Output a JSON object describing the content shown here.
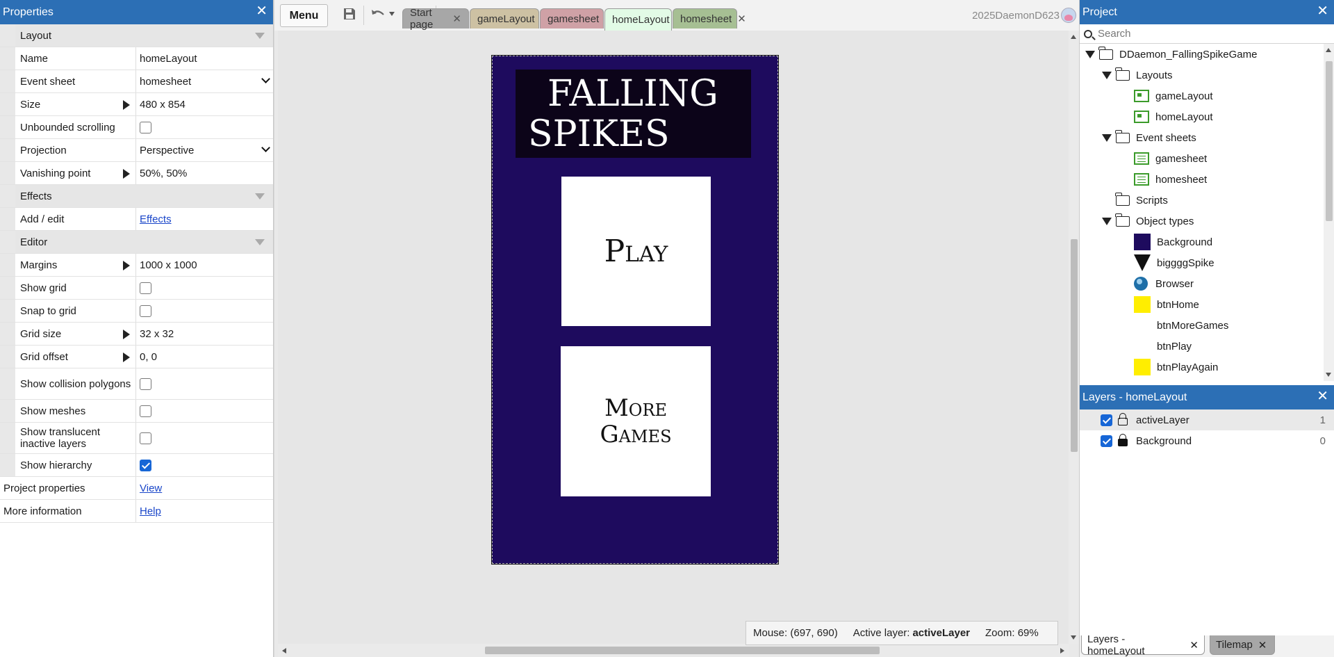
{
  "properties": {
    "title": "Properties",
    "rows": [
      {
        "type": "section",
        "label": "Layout"
      },
      {
        "type": "text",
        "label": "Name",
        "value": "homeLayout"
      },
      {
        "type": "select",
        "label": "Event sheet",
        "value": "homesheet"
      },
      {
        "type": "expand",
        "label": "Size",
        "value": "480 x 854"
      },
      {
        "type": "check",
        "label": "Unbounded scrolling",
        "checked": false
      },
      {
        "type": "select",
        "label": "Projection",
        "value": "Perspective"
      },
      {
        "type": "expand",
        "label": "Vanishing point",
        "value": "50%, 50%"
      },
      {
        "type": "section",
        "label": "Effects"
      },
      {
        "type": "link",
        "label": "Add / edit",
        "value": "Effects"
      },
      {
        "type": "section",
        "label": "Editor"
      },
      {
        "type": "expand",
        "label": "Margins",
        "value": "1000 x 1000"
      },
      {
        "type": "check",
        "label": "Show grid",
        "checked": false
      },
      {
        "type": "check",
        "label": "Snap to grid",
        "checked": false
      },
      {
        "type": "expand",
        "label": "Grid size",
        "value": "32 x 32"
      },
      {
        "type": "expand",
        "label": "Grid offset",
        "value": "0, 0"
      },
      {
        "type": "check",
        "label": "Show collision polygons",
        "checked": false,
        "tall": true
      },
      {
        "type": "check",
        "label": "Show meshes",
        "checked": false
      },
      {
        "type": "check",
        "label": "Show translucent inactive layers",
        "checked": false,
        "tall": true
      },
      {
        "type": "check",
        "label": "Show hierarchy",
        "checked": true
      },
      {
        "type": "link",
        "label": "Project properties",
        "value": "View",
        "nogutter": true
      },
      {
        "type": "link",
        "label": "More information",
        "value": "Help",
        "nogutter": true
      }
    ]
  },
  "toolbar": {
    "menu_label": "Menu",
    "user": "2025DaemonD623",
    "tabs": [
      {
        "label": "Start page",
        "color": "#a7a7a7"
      },
      {
        "label": "gameLayout",
        "color": "#cdc1a3"
      },
      {
        "label": "gamesheet",
        "color": "#cfa1a6"
      },
      {
        "label": "homeLayout",
        "color": "#e2fbe6",
        "active": true
      },
      {
        "label": "homesheet",
        "color": "#a6bf93"
      }
    ]
  },
  "layout_view": {
    "background_color": "#1e0b5e",
    "title_line1": "FALLING",
    "title_line2": "SPIKES",
    "play_label": "Play",
    "more_label_line1": "More",
    "more_label_line2": "Games"
  },
  "statusbar": {
    "mouse": "Mouse: (697, 690)",
    "active_layer_label": "Active layer:",
    "active_layer_value": "activeLayer",
    "zoom": "Zoom: 69%"
  },
  "project": {
    "title": "Project",
    "search_placeholder": "Search",
    "tree": [
      {
        "depth": 0,
        "kind": "folder",
        "twist": true,
        "label": "DDaemon_FallingSpikeGame"
      },
      {
        "depth": 1,
        "kind": "folder",
        "twist": true,
        "label": "Layouts"
      },
      {
        "depth": 2,
        "kind": "layout",
        "label": "gameLayout"
      },
      {
        "depth": 2,
        "kind": "layout",
        "label": "homeLayout"
      },
      {
        "depth": 1,
        "kind": "folder",
        "twist": true,
        "label": "Event sheets"
      },
      {
        "depth": 2,
        "kind": "sheet",
        "label": "gamesheet"
      },
      {
        "depth": 2,
        "kind": "sheet",
        "label": "homesheet"
      },
      {
        "depth": 1,
        "kind": "folder",
        "twist": false,
        "label": "Scripts"
      },
      {
        "depth": 1,
        "kind": "folder",
        "twist": true,
        "label": "Object types"
      },
      {
        "depth": 2,
        "kind": "swatch",
        "color": "#1e0b5e",
        "label": "Background"
      },
      {
        "depth": 2,
        "kind": "triangle",
        "label": "biggggSpike"
      },
      {
        "depth": 2,
        "kind": "globe",
        "label": "Browser"
      },
      {
        "depth": 2,
        "kind": "swatch",
        "color": "#ffee00",
        "label": "btnHome"
      },
      {
        "depth": 2,
        "kind": "none",
        "label": "btnMoreGames"
      },
      {
        "depth": 2,
        "kind": "none",
        "label": "btnPlay"
      },
      {
        "depth": 2,
        "kind": "swatch",
        "color": "#ffee00",
        "label": "btnPlayAgain"
      }
    ]
  },
  "layers": {
    "title": "Layers - homeLayout",
    "items": [
      {
        "label": "activeLayer",
        "count": "1",
        "visible": true,
        "locked": false,
        "active": true
      },
      {
        "label": "Background",
        "count": "0",
        "visible": true,
        "locked": true,
        "active": false
      }
    ]
  },
  "bottom_tabs": [
    {
      "label": "Layers - homeLayout",
      "active": true
    },
    {
      "label": "Tilemap",
      "active": false
    }
  ]
}
